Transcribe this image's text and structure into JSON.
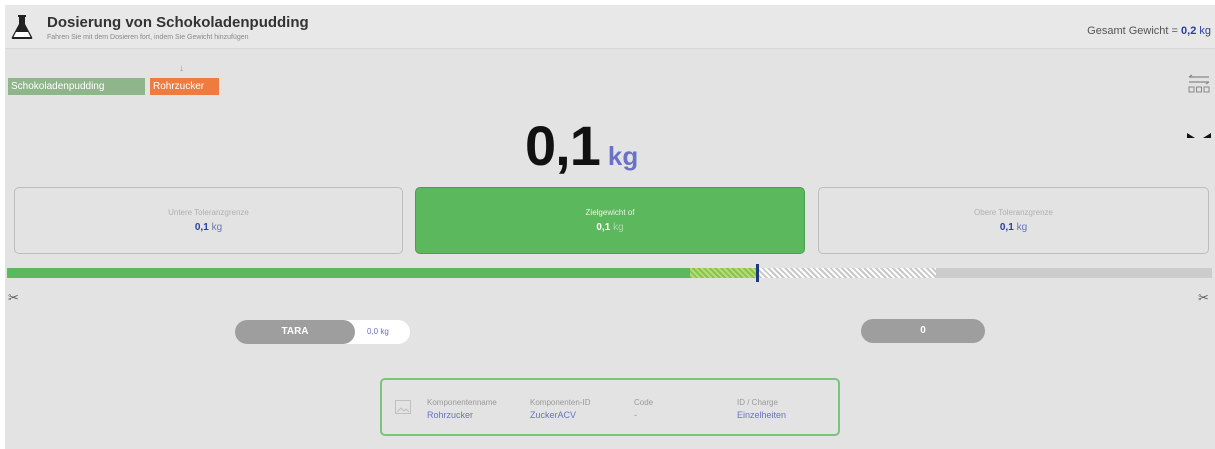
{
  "header": {
    "title": "Dosierung von Schokoladenpudding",
    "subtitle": "Fahren Sie mit dem Dosieren fort, indem Sie Gewicht hinzufügen",
    "total_label": "Gesamt Gewicht = ",
    "total_value": "0,2",
    "total_unit": "kg",
    "icon": "flask-icon"
  },
  "components": {
    "tags": [
      "Schokoladenpudding",
      "Rohrzucker"
    ],
    "current_arrow": "↓"
  },
  "current_weight": {
    "value": "0,1",
    "unit": "kg"
  },
  "tolerance": {
    "lower": {
      "label": "Untere Toleranzgrenze",
      "value": "0,1",
      "unit": "kg"
    },
    "target": {
      "label": "Zielgewicht of",
      "value": "0,1",
      "unit": "kg"
    },
    "upper": {
      "label": "Obere Toleranzgrenze",
      "value": "0,1",
      "unit": "kg"
    }
  },
  "progress": {
    "fill_fraction": 0.567,
    "tolerance_start": 0.567,
    "tolerance_end": 0.622,
    "hatch_end": 0.771,
    "marker": 0.622
  },
  "tara": {
    "label": "TARA",
    "value": "0,0",
    "unit": "kg"
  },
  "counter": {
    "value": "0"
  },
  "info": {
    "columns": [
      {
        "header": "Komponentenname",
        "value": "Rohrzucker"
      },
      {
        "header": "Komponenten-ID",
        "value": "ZuckerACV"
      },
      {
        "header": "Code",
        "value": "-"
      },
      {
        "header": "ID / Charge",
        "value": "Einzelheiten"
      }
    ]
  },
  "colors": {
    "accent": "#5cb85c",
    "value_blue": "#2c3f9e",
    "unit_blue": "#6a71c6",
    "orange": "#f07b3f"
  }
}
